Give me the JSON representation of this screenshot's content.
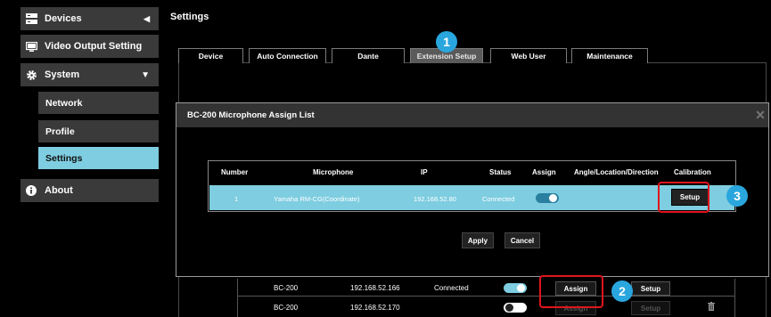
{
  "sidebar": {
    "devices": "Devices",
    "video_output": "Video Output Setting",
    "system": "System",
    "network": "Network",
    "profile": "Profile",
    "settings": "Settings",
    "about": "About"
  },
  "page_title": "Settings",
  "tabs": [
    "Device",
    "Auto Connection",
    "Dante",
    "Extension Setup",
    "Web User",
    "Maintenance"
  ],
  "active_tab": "Extension Setup",
  "dialog": {
    "title": "BC-200 Microphone Assign List",
    "columns": [
      "Number",
      "Microphone",
      "IP",
      "Status",
      "Assign",
      "Angle/Location/Direction",
      "Calibration"
    ],
    "row": {
      "number": "1",
      "microphone": "Yamaha RM-CG(Coordinate)",
      "ip": "192.168.52.80",
      "status": "Connected",
      "assign": "on",
      "calibration_button": "Setup"
    },
    "apply": "Apply",
    "cancel": "Cancel"
  },
  "device_rows": [
    {
      "name": "BC-200",
      "ip": "192.168.52.166",
      "status": "Connected",
      "assign_toggle": "on",
      "assign_button": "Assign",
      "setup_button": "Setup"
    },
    {
      "name": "BC-200",
      "ip": "192.168.52.170",
      "status": "",
      "assign_toggle": "off",
      "assign_button": "Assign",
      "setup_button": "Setup"
    }
  ],
  "callouts": [
    "1",
    "2",
    "3"
  ],
  "colors": {
    "accent": "#7ecde0",
    "highlight": "#e0141c",
    "badge": "#2aa6de"
  }
}
